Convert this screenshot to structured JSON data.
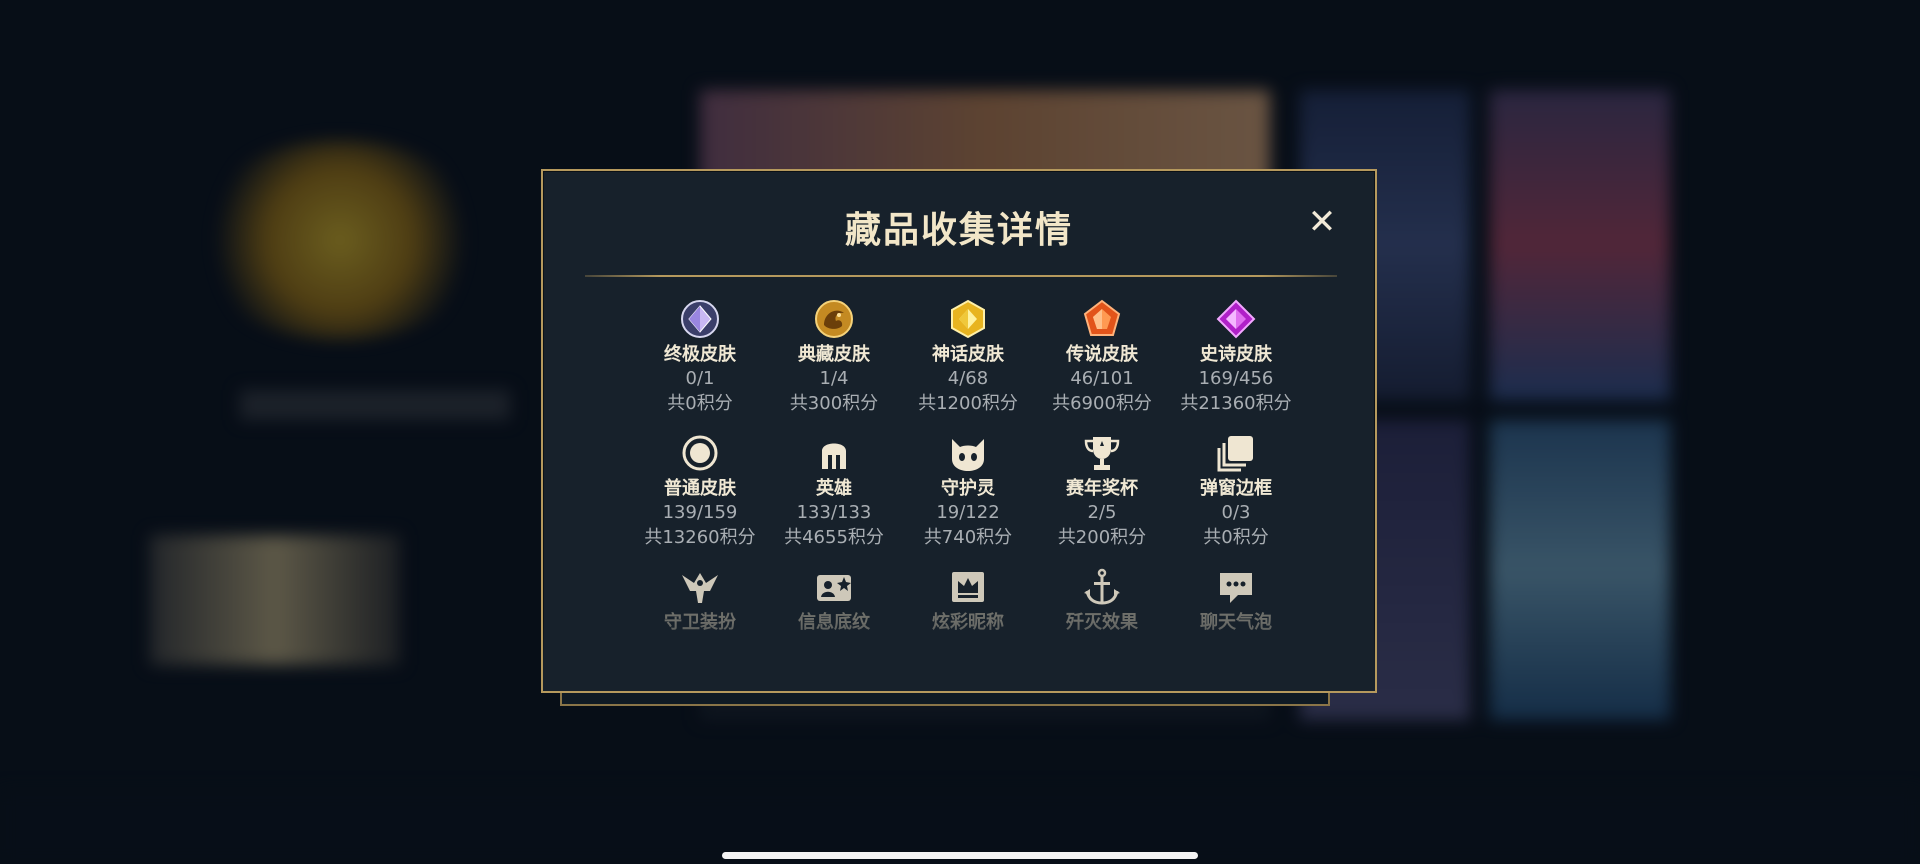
{
  "modal": {
    "title": "藏品收集详情",
    "close_symbol": "✕",
    "rows": [
      [
        {
          "name": "终极皮肤",
          "count": "0/1",
          "points": "共0积分",
          "icon": "ultimate-gem-icon"
        },
        {
          "name": "典藏皮肤",
          "count": "1/4",
          "points": "共300积分",
          "icon": "collection-dragon-icon"
        },
        {
          "name": "神话皮肤",
          "count": "4/68",
          "points": "共1200积分",
          "icon": "myth-gem-icon"
        },
        {
          "name": "传说皮肤",
          "count": "46/101",
          "points": "共6900积分",
          "icon": "legend-gem-icon"
        },
        {
          "name": "史诗皮肤",
          "count": "169/456",
          "points": "共21360积分",
          "icon": "epic-gem-icon"
        }
      ],
      [
        {
          "name": "普通皮肤",
          "count": "139/159",
          "points": "共13260积分",
          "icon": "circle-icon"
        },
        {
          "name": "英雄",
          "count": "133/133",
          "points": "共4655积分",
          "icon": "helmet-icon"
        },
        {
          "name": "守护灵",
          "count": "19/122",
          "points": "共740积分",
          "icon": "guardian-pet-icon"
        },
        {
          "name": "赛年奖杯",
          "count": "2/5",
          "points": "共200积分",
          "icon": "trophy-icon"
        },
        {
          "name": "弹窗边框",
          "count": "0/3",
          "points": "共0积分",
          "icon": "frames-icon"
        }
      ],
      [
        {
          "name": "守卫装扮",
          "icon": "ward-icon"
        },
        {
          "name": "信息底纹",
          "icon": "profile-card-icon"
        },
        {
          "name": "炫彩昵称",
          "icon": "crown-nameplate-icon"
        },
        {
          "name": "歼灭效果",
          "icon": "anchor-icon"
        },
        {
          "name": "聊天气泡",
          "icon": "chat-bubble-icon"
        }
      ]
    ]
  },
  "colors": {
    "gold_border": "#b5995d",
    "title": "#f2e6c8",
    "panel": "#17212b"
  }
}
